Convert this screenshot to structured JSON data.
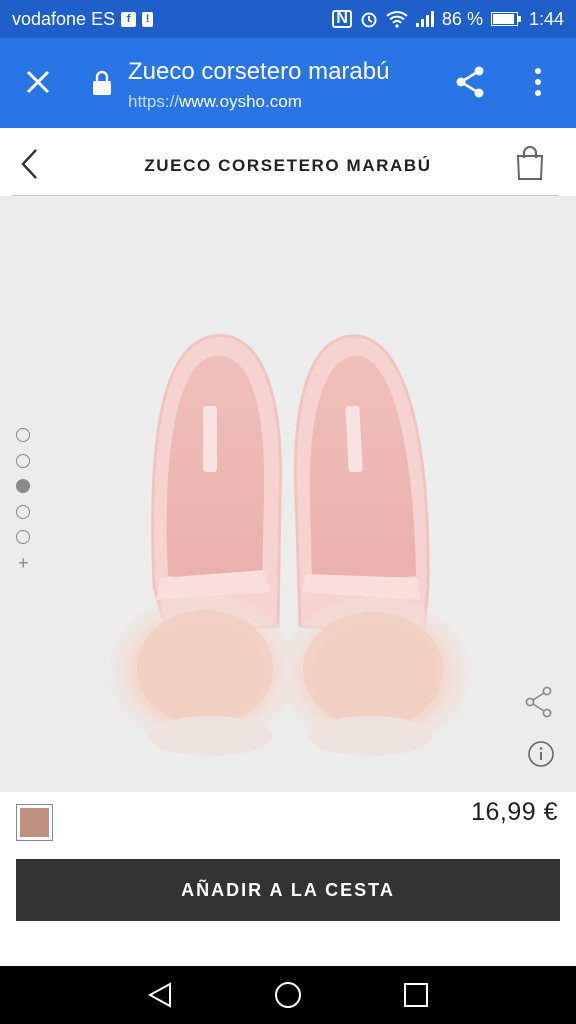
{
  "status_bar": {
    "carrier": "vodafone ES",
    "battery": "86 %",
    "time": "1:44"
  },
  "browser": {
    "page_title": "Zueco corsetero marabú",
    "url_scheme": "https://",
    "url_host": "www.oysho.com"
  },
  "header": {
    "title": "ZUECO CORSETERO MARABÚ"
  },
  "gallery": {
    "dot_count": 5,
    "active_index": 2,
    "more_label": "+"
  },
  "product": {
    "price": "16,99 €",
    "color_swatch": "#c09080"
  },
  "cta": {
    "label": "AÑADIR A LA CESTA"
  },
  "colors": {
    "status_bar": "#1e5fc9",
    "toolbar": "#2a75e6",
    "cta_background": "#333333",
    "slipper_pink": "#f0c8c4"
  }
}
